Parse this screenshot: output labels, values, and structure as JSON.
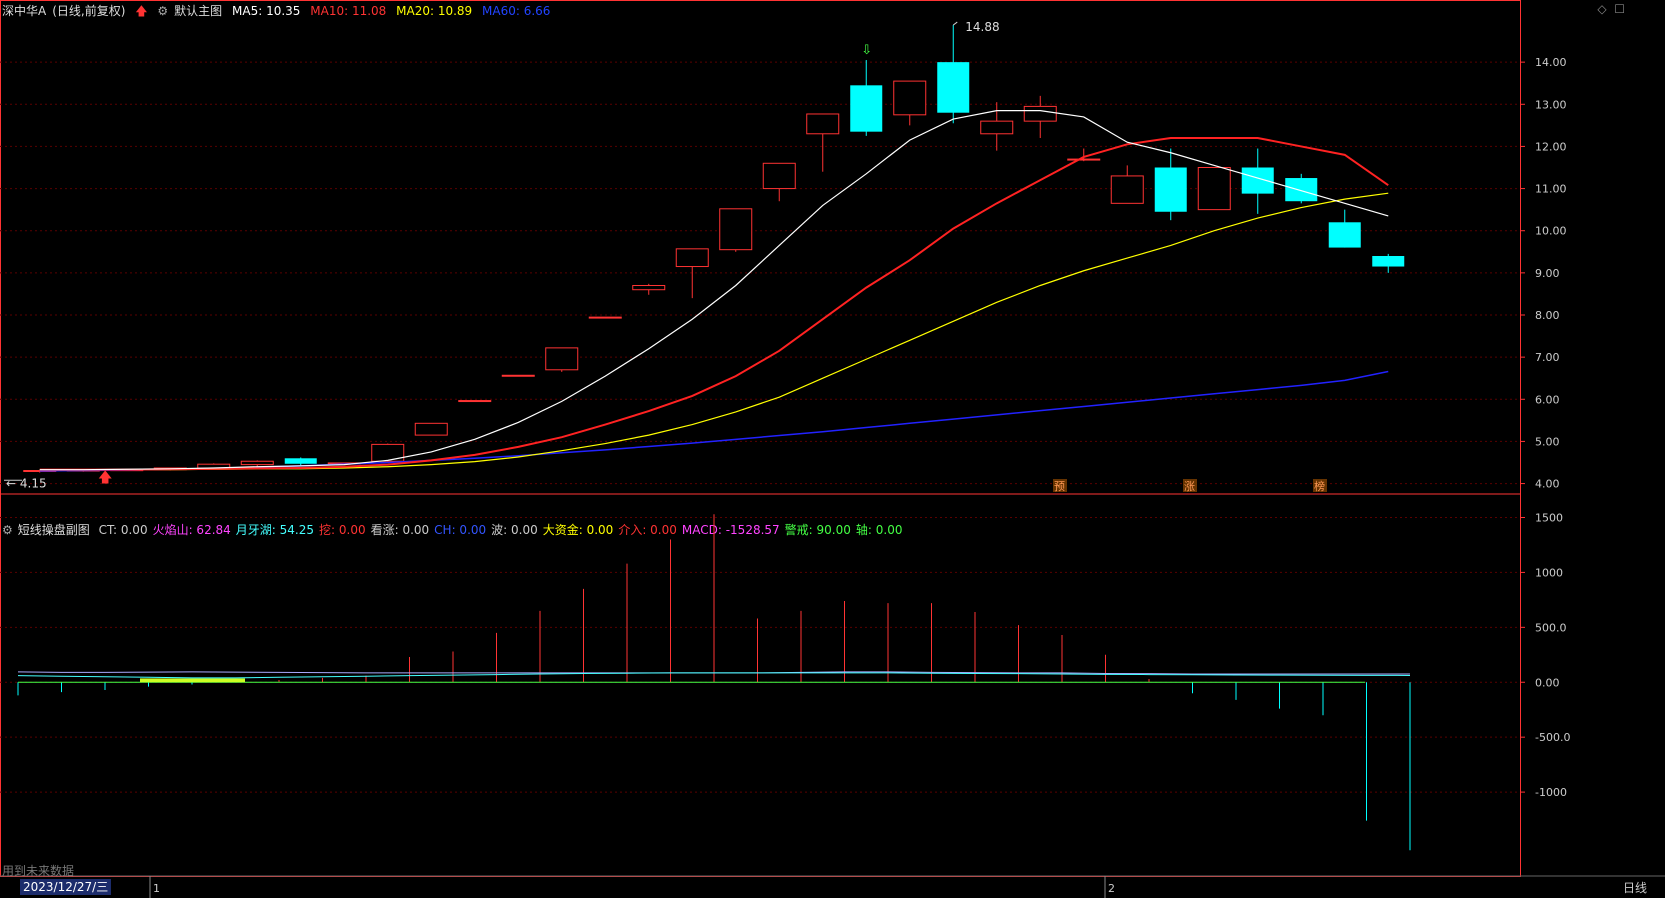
{
  "main_legend": {
    "stock": "深中华A",
    "mode": "(日线,前复权)",
    "indicator": "默认主图",
    "ma5": "MA5: 10.35",
    "ma10": "MA10: 11.08",
    "ma20": "MA20: 10.89",
    "ma60": "MA60: 6.66"
  },
  "sub_legend": {
    "name": "短线操盘副图",
    "items": [
      {
        "text": "CT: 0.00",
        "color": "#cccccc"
      },
      {
        "text": "火焰山: 62.84",
        "color": "#ff44ff"
      },
      {
        "text": "月牙湖: 54.25",
        "color": "#44ffff"
      },
      {
        "text": "挖: 0.00",
        "color": "#ff3333"
      },
      {
        "text": "看涨: 0.00",
        "color": "#cccccc"
      },
      {
        "text": "CH: 0.00",
        "color": "#3355ff"
      },
      {
        "text": "波: 0.00",
        "color": "#cccccc"
      },
      {
        "text": "大资金: 0.00",
        "color": "#ffff00"
      },
      {
        "text": "介入: 0.00",
        "color": "#ff3333"
      },
      {
        "text": "MACD: -1528.57",
        "color": "#ff44ff"
      },
      {
        "text": "警戒: 90.00",
        "color": "#44ff44"
      },
      {
        "text": "轴: 0.00",
        "color": "#44ff44"
      }
    ]
  },
  "colors": {
    "up": "#ff3333",
    "down": "#00ffff",
    "ma5": "#ffffff",
    "ma10": "#ff2222",
    "ma20": "#ffff00",
    "ma60": "#2222ff",
    "grid": "#5a0000",
    "axis": "#ff3333"
  },
  "price_axis": {
    "ticks": [
      "14.00",
      "13.00",
      "12.00",
      "11.00",
      "10.00",
      "9.00",
      "8.00",
      "7.00",
      "6.00",
      "5.00",
      "4.00"
    ]
  },
  "sub_axis": {
    "ticks": [
      "1500",
      "1000",
      "500.0",
      "0.00",
      "-500.0",
      "-1000"
    ]
  },
  "annotations": {
    "high": "14.88",
    "low": "4.15"
  },
  "markers": [
    "预",
    "涨",
    "榜"
  ],
  "bottom": {
    "date": "2023/12/27/三",
    "future": "用到未来数据",
    "period": "日线",
    "month1": "1",
    "month2": "2"
  },
  "chart_data": {
    "type": "candlestick",
    "ylim": [
      3.8,
      15.0
    ],
    "candles": [
      {
        "o": 4.3,
        "h": 4.32,
        "l": 4.26,
        "c": 4.31
      },
      {
        "o": 4.31,
        "h": 4.33,
        "l": 4.28,
        "c": 4.32
      },
      {
        "o": 4.32,
        "h": 4.34,
        "l": 4.3,
        "c": 4.33
      },
      {
        "o": 4.33,
        "h": 4.38,
        "l": 4.31,
        "c": 4.37
      },
      {
        "o": 4.37,
        "h": 4.48,
        "l": 4.35,
        "c": 4.46
      },
      {
        "o": 4.45,
        "h": 4.55,
        "l": 4.4,
        "c": 4.53
      },
      {
        "o": 4.6,
        "h": 4.62,
        "l": 4.43,
        "c": 4.47
      },
      {
        "o": 4.47,
        "h": 4.5,
        "l": 4.44,
        "c": 4.49
      },
      {
        "o": 4.53,
        "h": 4.95,
        "l": 4.5,
        "c": 4.93
      },
      {
        "o": 5.15,
        "h": 5.43,
        "l": 5.15,
        "c": 5.43
      },
      {
        "o": 5.97,
        "h": 5.97,
        "l": 5.97,
        "c": 5.97
      },
      {
        "o": 6.57,
        "h": 6.57,
        "l": 6.57,
        "c": 6.57
      },
      {
        "o": 6.7,
        "h": 7.22,
        "l": 6.65,
        "c": 7.22
      },
      {
        "o": 7.95,
        "h": 7.95,
        "l": 7.95,
        "c": 7.95
      },
      {
        "o": 8.6,
        "h": 8.74,
        "l": 8.48,
        "c": 8.7
      },
      {
        "o": 9.15,
        "h": 9.57,
        "l": 8.4,
        "c": 9.57
      },
      {
        "o": 9.55,
        "h": 10.52,
        "l": 9.5,
        "c": 10.52
      },
      {
        "o": 11.0,
        "h": 11.6,
        "l": 10.7,
        "c": 11.6
      },
      {
        "o": 12.3,
        "h": 12.77,
        "l": 11.4,
        "c": 12.77
      },
      {
        "o": 13.45,
        "h": 14.05,
        "l": 12.25,
        "c": 12.35
      },
      {
        "o": 12.75,
        "h": 13.55,
        "l": 12.5,
        "c": 13.55
      },
      {
        "o": 14.0,
        "h": 14.88,
        "l": 12.55,
        "c": 12.8
      },
      {
        "o": 12.3,
        "h": 13.05,
        "l": 11.9,
        "c": 12.6
      },
      {
        "o": 12.6,
        "h": 13.2,
        "l": 12.2,
        "c": 12.95
      },
      {
        "o": 11.7,
        "h": 11.95,
        "l": 11.65,
        "c": 11.7
      },
      {
        "o": 10.65,
        "h": 11.55,
        "l": 10.65,
        "c": 11.3
      },
      {
        "o": 11.5,
        "h": 11.95,
        "l": 10.25,
        "c": 10.45
      },
      {
        "o": 10.5,
        "h": 11.5,
        "l": 10.5,
        "c": 11.5
      },
      {
        "o": 11.5,
        "h": 11.95,
        "l": 10.4,
        "c": 10.88
      },
      {
        "o": 11.25,
        "h": 11.35,
        "l": 10.65,
        "c": 10.7
      },
      {
        "o": 10.2,
        "h": 10.5,
        "l": 9.6,
        "c": 9.6
      },
      {
        "o": 9.4,
        "h": 9.45,
        "l": 9.0,
        "c": 9.15
      }
    ],
    "ma5": [
      4.33,
      4.33,
      4.34,
      4.35,
      4.37,
      4.4,
      4.42,
      4.45,
      4.55,
      4.75,
      5.05,
      5.45,
      5.95,
      6.55,
      7.2,
      7.9,
      8.7,
      9.65,
      10.6,
      11.35,
      12.15,
      12.65,
      12.85,
      12.85,
      12.7,
      12.1,
      11.85,
      11.55,
      11.25,
      10.95,
      10.65,
      10.35
    ],
    "ma10": [
      4.33,
      4.33,
      4.33,
      4.34,
      4.35,
      4.36,
      4.37,
      4.4,
      4.45,
      4.55,
      4.68,
      4.87,
      5.1,
      5.4,
      5.72,
      6.08,
      6.55,
      7.15,
      7.9,
      8.65,
      9.3,
      10.05,
      10.65,
      11.2,
      11.75,
      12.05,
      12.2,
      12.2,
      12.2,
      12.0,
      11.8,
      11.08
    ],
    "ma20": [
      4.33,
      4.33,
      4.33,
      4.33,
      4.34,
      4.35,
      4.35,
      4.37,
      4.4,
      4.45,
      4.52,
      4.63,
      4.78,
      4.95,
      5.15,
      5.4,
      5.7,
      6.05,
      6.5,
      6.95,
      7.4,
      7.85,
      8.3,
      8.7,
      9.05,
      9.35,
      9.65,
      10.0,
      10.3,
      10.55,
      10.75,
      10.89
    ],
    "ma60": [
      4.3,
      4.31,
      4.32,
      4.34,
      4.36,
      4.39,
      4.42,
      4.46,
      4.5,
      4.55,
      4.6,
      4.66,
      4.73,
      4.8,
      4.88,
      4.96,
      5.05,
      5.14,
      5.23,
      5.33,
      5.43,
      5.53,
      5.63,
      5.73,
      5.83,
      5.93,
      6.03,
      6.13,
      6.23,
      6.33,
      6.45,
      6.66
    ],
    "sub_series": {
      "ylim": [
        -1600,
        1550
      ],
      "bars": [
        -120,
        -90,
        -70,
        -40,
        -20,
        10,
        20,
        40,
        60,
        230,
        280,
        450,
        650,
        850,
        1080,
        1300,
        1530,
        580,
        650,
        740,
        720,
        720,
        640,
        520,
        430,
        250,
        30,
        -100,
        -160,
        -240,
        -300,
        -1260,
        -1530
      ],
      "line1": [
        95,
        90,
        90,
        92,
        95,
        92,
        90,
        88,
        85,
        85,
        85,
        85,
        85,
        85,
        85,
        85,
        85,
        85,
        90,
        95,
        95,
        90,
        88,
        85,
        85,
        80,
        78,
        75,
        75,
        75,
        75,
        75,
        75
      ],
      "line2": [
        60,
        55,
        50,
        45,
        40,
        40,
        45,
        50,
        55,
        60,
        65,
        70,
        75,
        80,
        82,
        85,
        85,
        85,
        85,
        85,
        85,
        82,
        80,
        78,
        75,
        72,
        70,
        68,
        66,
        65,
        64,
        63,
        62
      ]
    }
  }
}
